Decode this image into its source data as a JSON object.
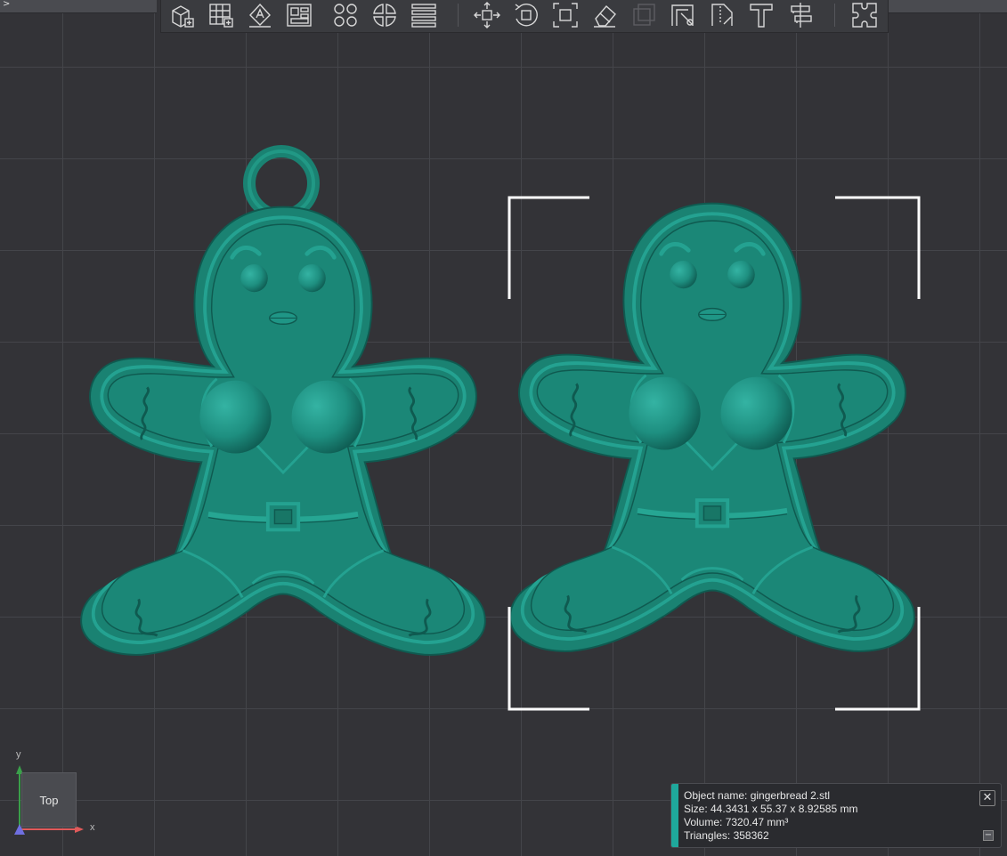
{
  "toolbar": {
    "groups": [
      [
        "add-part",
        "arrange-plate",
        "auto-label",
        "layout",
        "split-objects",
        "split-parts",
        "layers"
      ],
      [
        "move",
        "rotate",
        "scale",
        "erase",
        "color-paint",
        "cut-height",
        "cut-line",
        "text",
        "measure"
      ],
      [
        "assembly"
      ]
    ]
  },
  "scene": {
    "object_color": "#1e8f80",
    "selection_color": "#ffffff",
    "objects": [
      "gingerbread",
      "gingerbread 2.stl"
    ]
  },
  "object_info": {
    "name_line": "Object name: gingerbread 2.stl",
    "size_line": "Size: 44.3431 x 55.37 x 8.92585 mm",
    "volume_line": "Volume: 7320.47 mm³",
    "triangles_line": "Triangles: 358362",
    "close_glyph": "✕",
    "minimize_glyph": "−",
    "accent_color": "#1fa89c"
  },
  "view": {
    "cube_label": "Top",
    "axis_y": "y",
    "axis_x": "x"
  },
  "topbar": {
    "expand_glyph": ">"
  }
}
